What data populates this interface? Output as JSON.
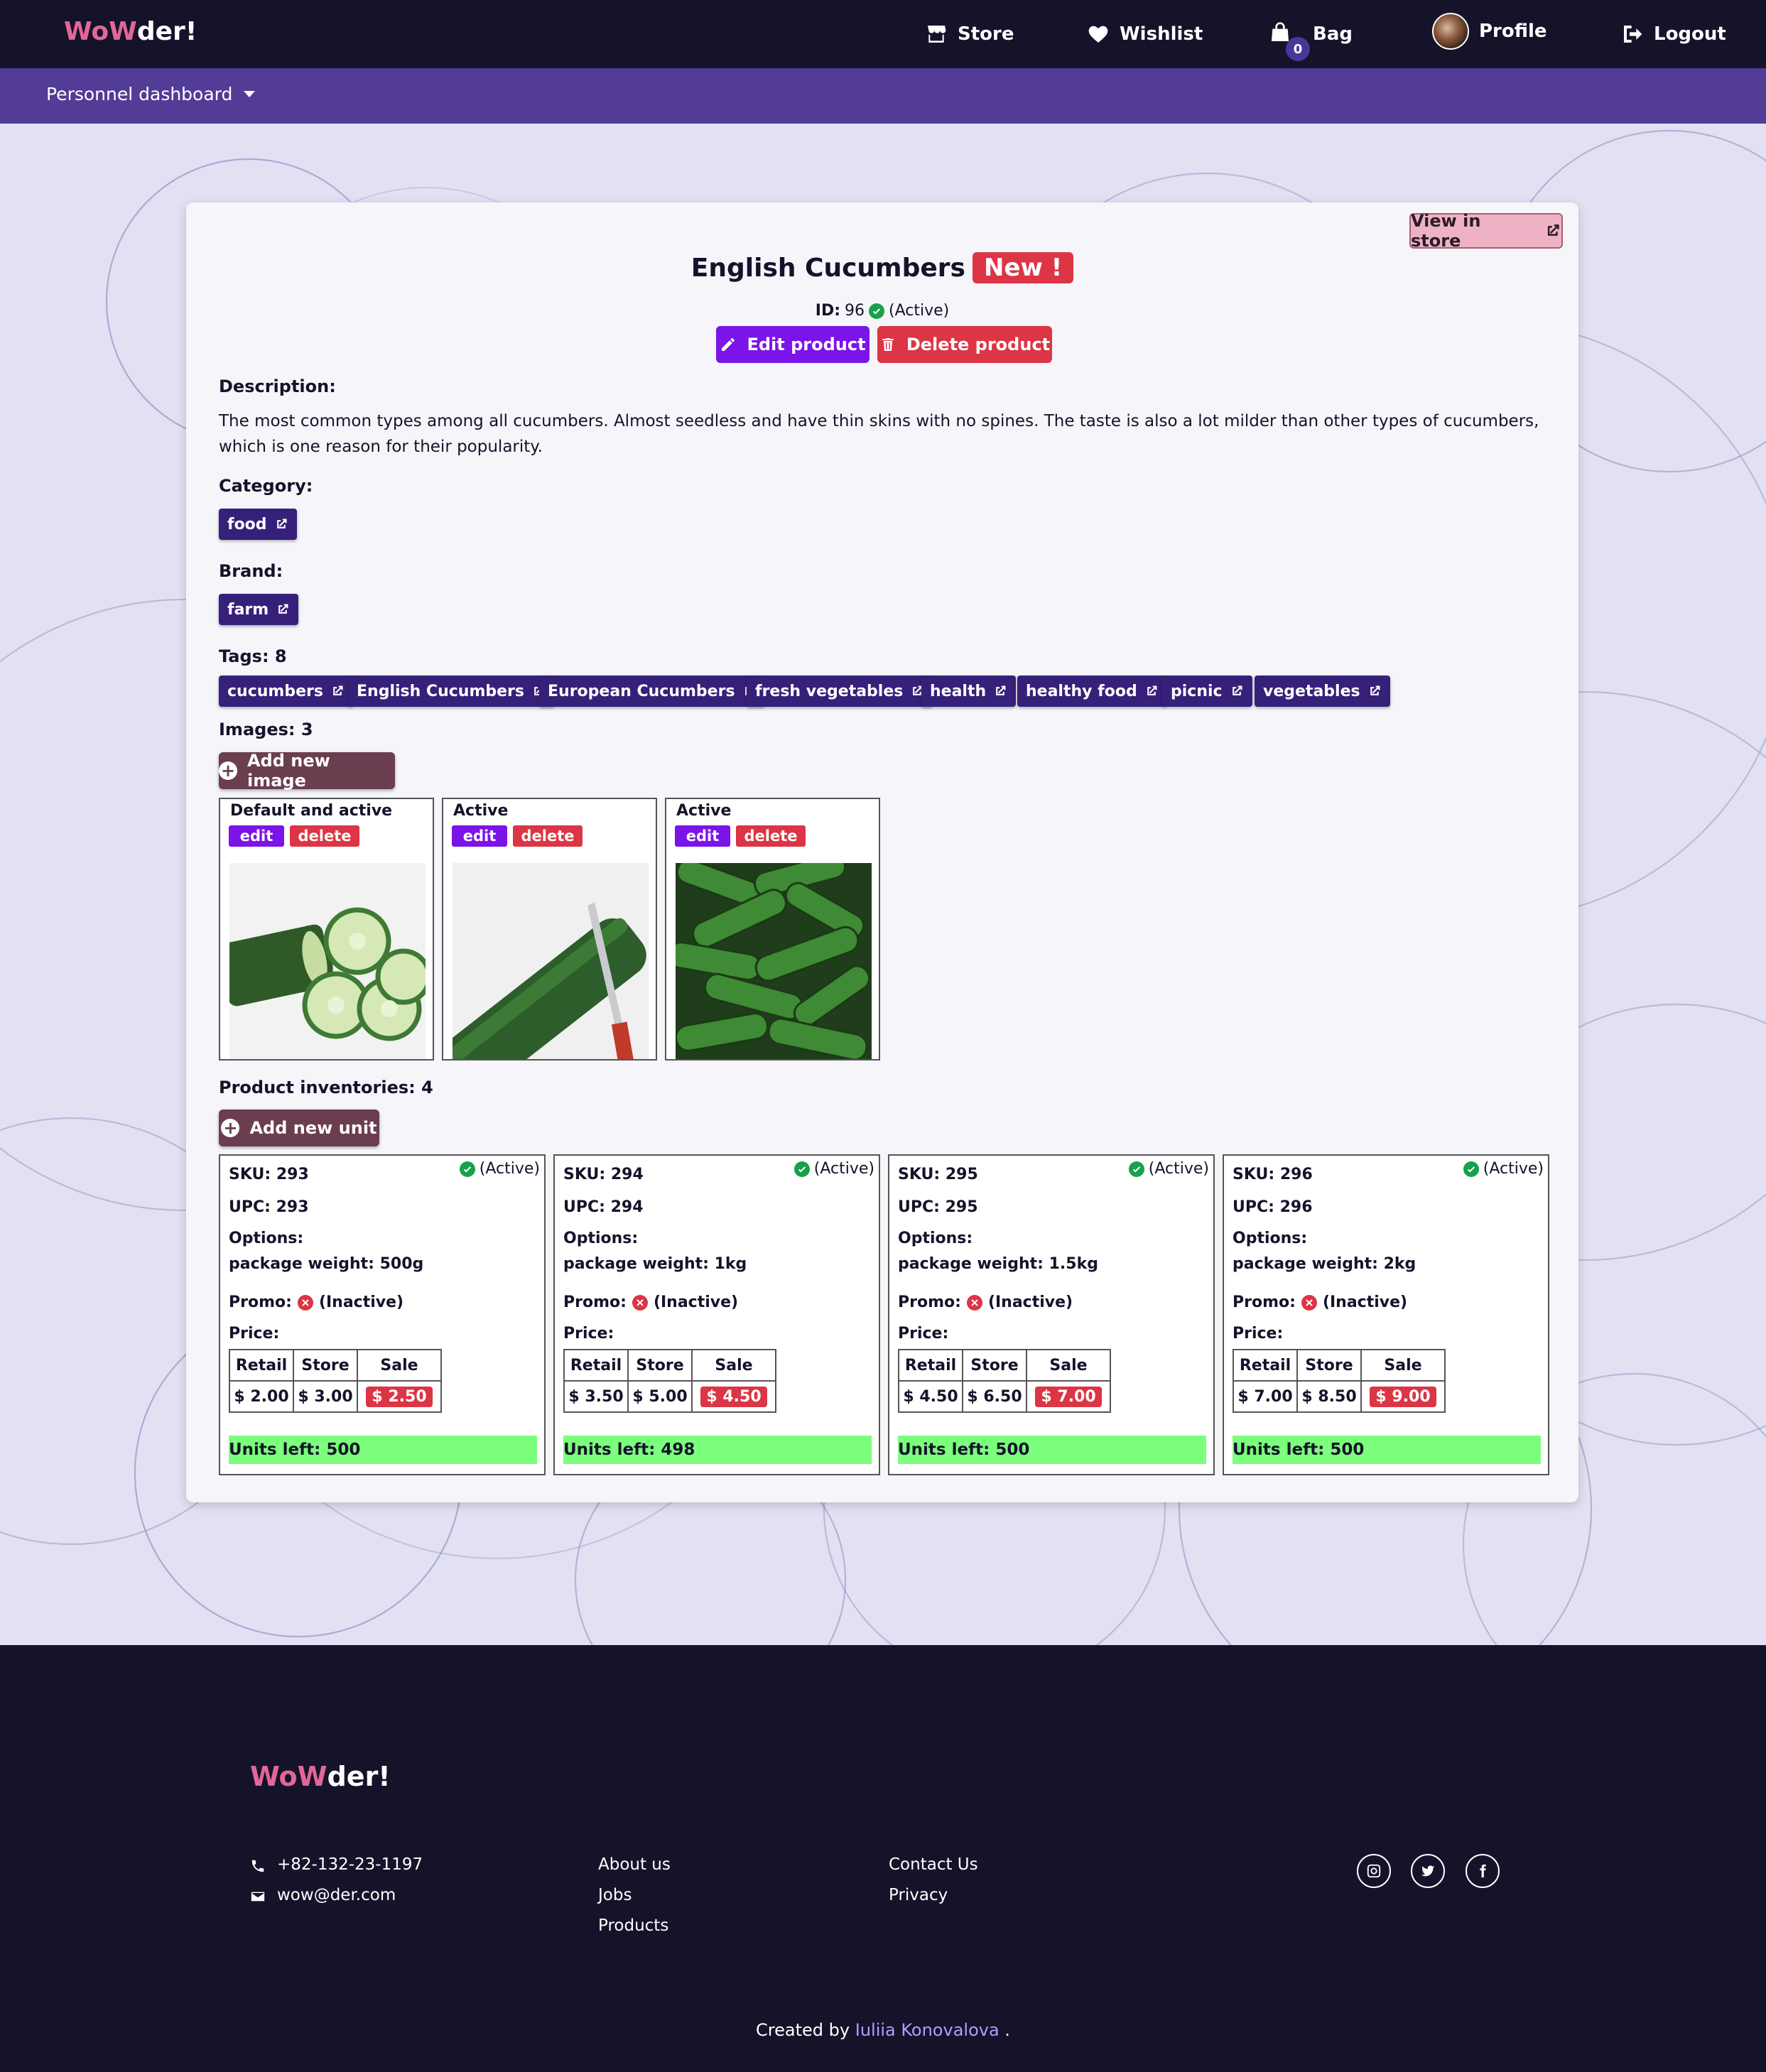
{
  "brand": {
    "logo_accent": "WoW",
    "logo_rest": "der!"
  },
  "nav": {
    "store": "Store",
    "wishlist": "Wishlist",
    "bag": "Bag",
    "bag_count": "0",
    "profile": "Profile",
    "logout": "Logout"
  },
  "subnav": {
    "dashboard": "Personnel dashboard"
  },
  "product": {
    "view_in_store": "View in store",
    "name": "English Cucumbers",
    "badge": "New !",
    "id_label": "ID:",
    "id": "96",
    "status": "(Active)",
    "edit_label": "Edit product",
    "delete_label": "Delete product",
    "description_label": "Description:",
    "description": "The most common types among all cucumbers. Almost seedless and have thin skins with no spines. The taste is also a lot milder than other types of cucumbers, which is one reason for their popularity.",
    "category_label": "Category:",
    "category": "food",
    "brand_label": "Brand:",
    "brand": "farm",
    "tags_label": "Tags: 8",
    "tags": [
      "cucumbers",
      "English Cucumbers",
      "European Cucumbers",
      "fresh vegetables",
      "health",
      "healthy food",
      "picnic",
      "vegetables"
    ],
    "images_label": "Images: 3",
    "add_image": "Add new image",
    "images": [
      {
        "status": "Default and active",
        "edit": "edit",
        "delete": "delete"
      },
      {
        "status": "Active",
        "edit": "edit",
        "delete": "delete"
      },
      {
        "status": "Active",
        "edit": "edit",
        "delete": "delete"
      }
    ],
    "inventories_label": "Product inventories: 4",
    "add_unit": "Add new unit",
    "inventories": [
      {
        "sku": "293",
        "upc": "293",
        "option": "package weight: 500g",
        "retail": "$ 2.00",
        "store": "$ 3.00",
        "sale": "$ 2.50",
        "units": "Units left: 500"
      },
      {
        "sku": "294",
        "upc": "294",
        "option": "package weight: 1kg",
        "retail": "$ 3.50",
        "store": "$ 5.00",
        "sale": "$ 4.50",
        "units": "Units left: 498"
      },
      {
        "sku": "295",
        "upc": "295",
        "option": "package weight: 1.5kg",
        "retail": "$ 4.50",
        "store": "$ 6.50",
        "sale": "$ 7.00",
        "units": "Units left: 500"
      },
      {
        "sku": "296",
        "upc": "296",
        "option": "package weight: 2kg",
        "retail": "$ 7.00",
        "store": "$ 8.50",
        "sale": "$ 9.00",
        "units": "Units left: 500"
      }
    ],
    "inv_labels": {
      "sku": "SKU:",
      "upc": "UPC:",
      "options": "Options:",
      "promo": "Promo:",
      "promo_status": "(Inactive)",
      "price": "Price:",
      "active": "(Active)",
      "retail": "Retail",
      "store": "Store",
      "sale": "Sale"
    }
  },
  "footer": {
    "phone": "+82-132-23-1197",
    "email": "wow@der.com",
    "links_col1": [
      "About us",
      "Jobs",
      "Products"
    ],
    "links_col2": [
      "Contact Us",
      "Privacy"
    ],
    "credit_prefix": "Created by",
    "credit_author": "Iuliia Konovalova",
    "credit_suffix": "."
  },
  "colors": {
    "navbar": "#14132a",
    "subnav": "#523c96",
    "accent_purple": "#7b14e8",
    "danger": "#dc3545",
    "tag": "#36207a",
    "units_bg": "#7cff7c",
    "logo_pink": "#e2669a"
  },
  "icons": [
    "store-icon",
    "heart-icon",
    "bag-icon",
    "logout-icon",
    "external-link-icon",
    "pencil-icon",
    "trash-icon",
    "check-circle-icon",
    "x-circle-icon",
    "plus-circle-icon",
    "phone-icon",
    "envelope-icon",
    "instagram-icon",
    "twitter-icon",
    "facebook-icon"
  ]
}
